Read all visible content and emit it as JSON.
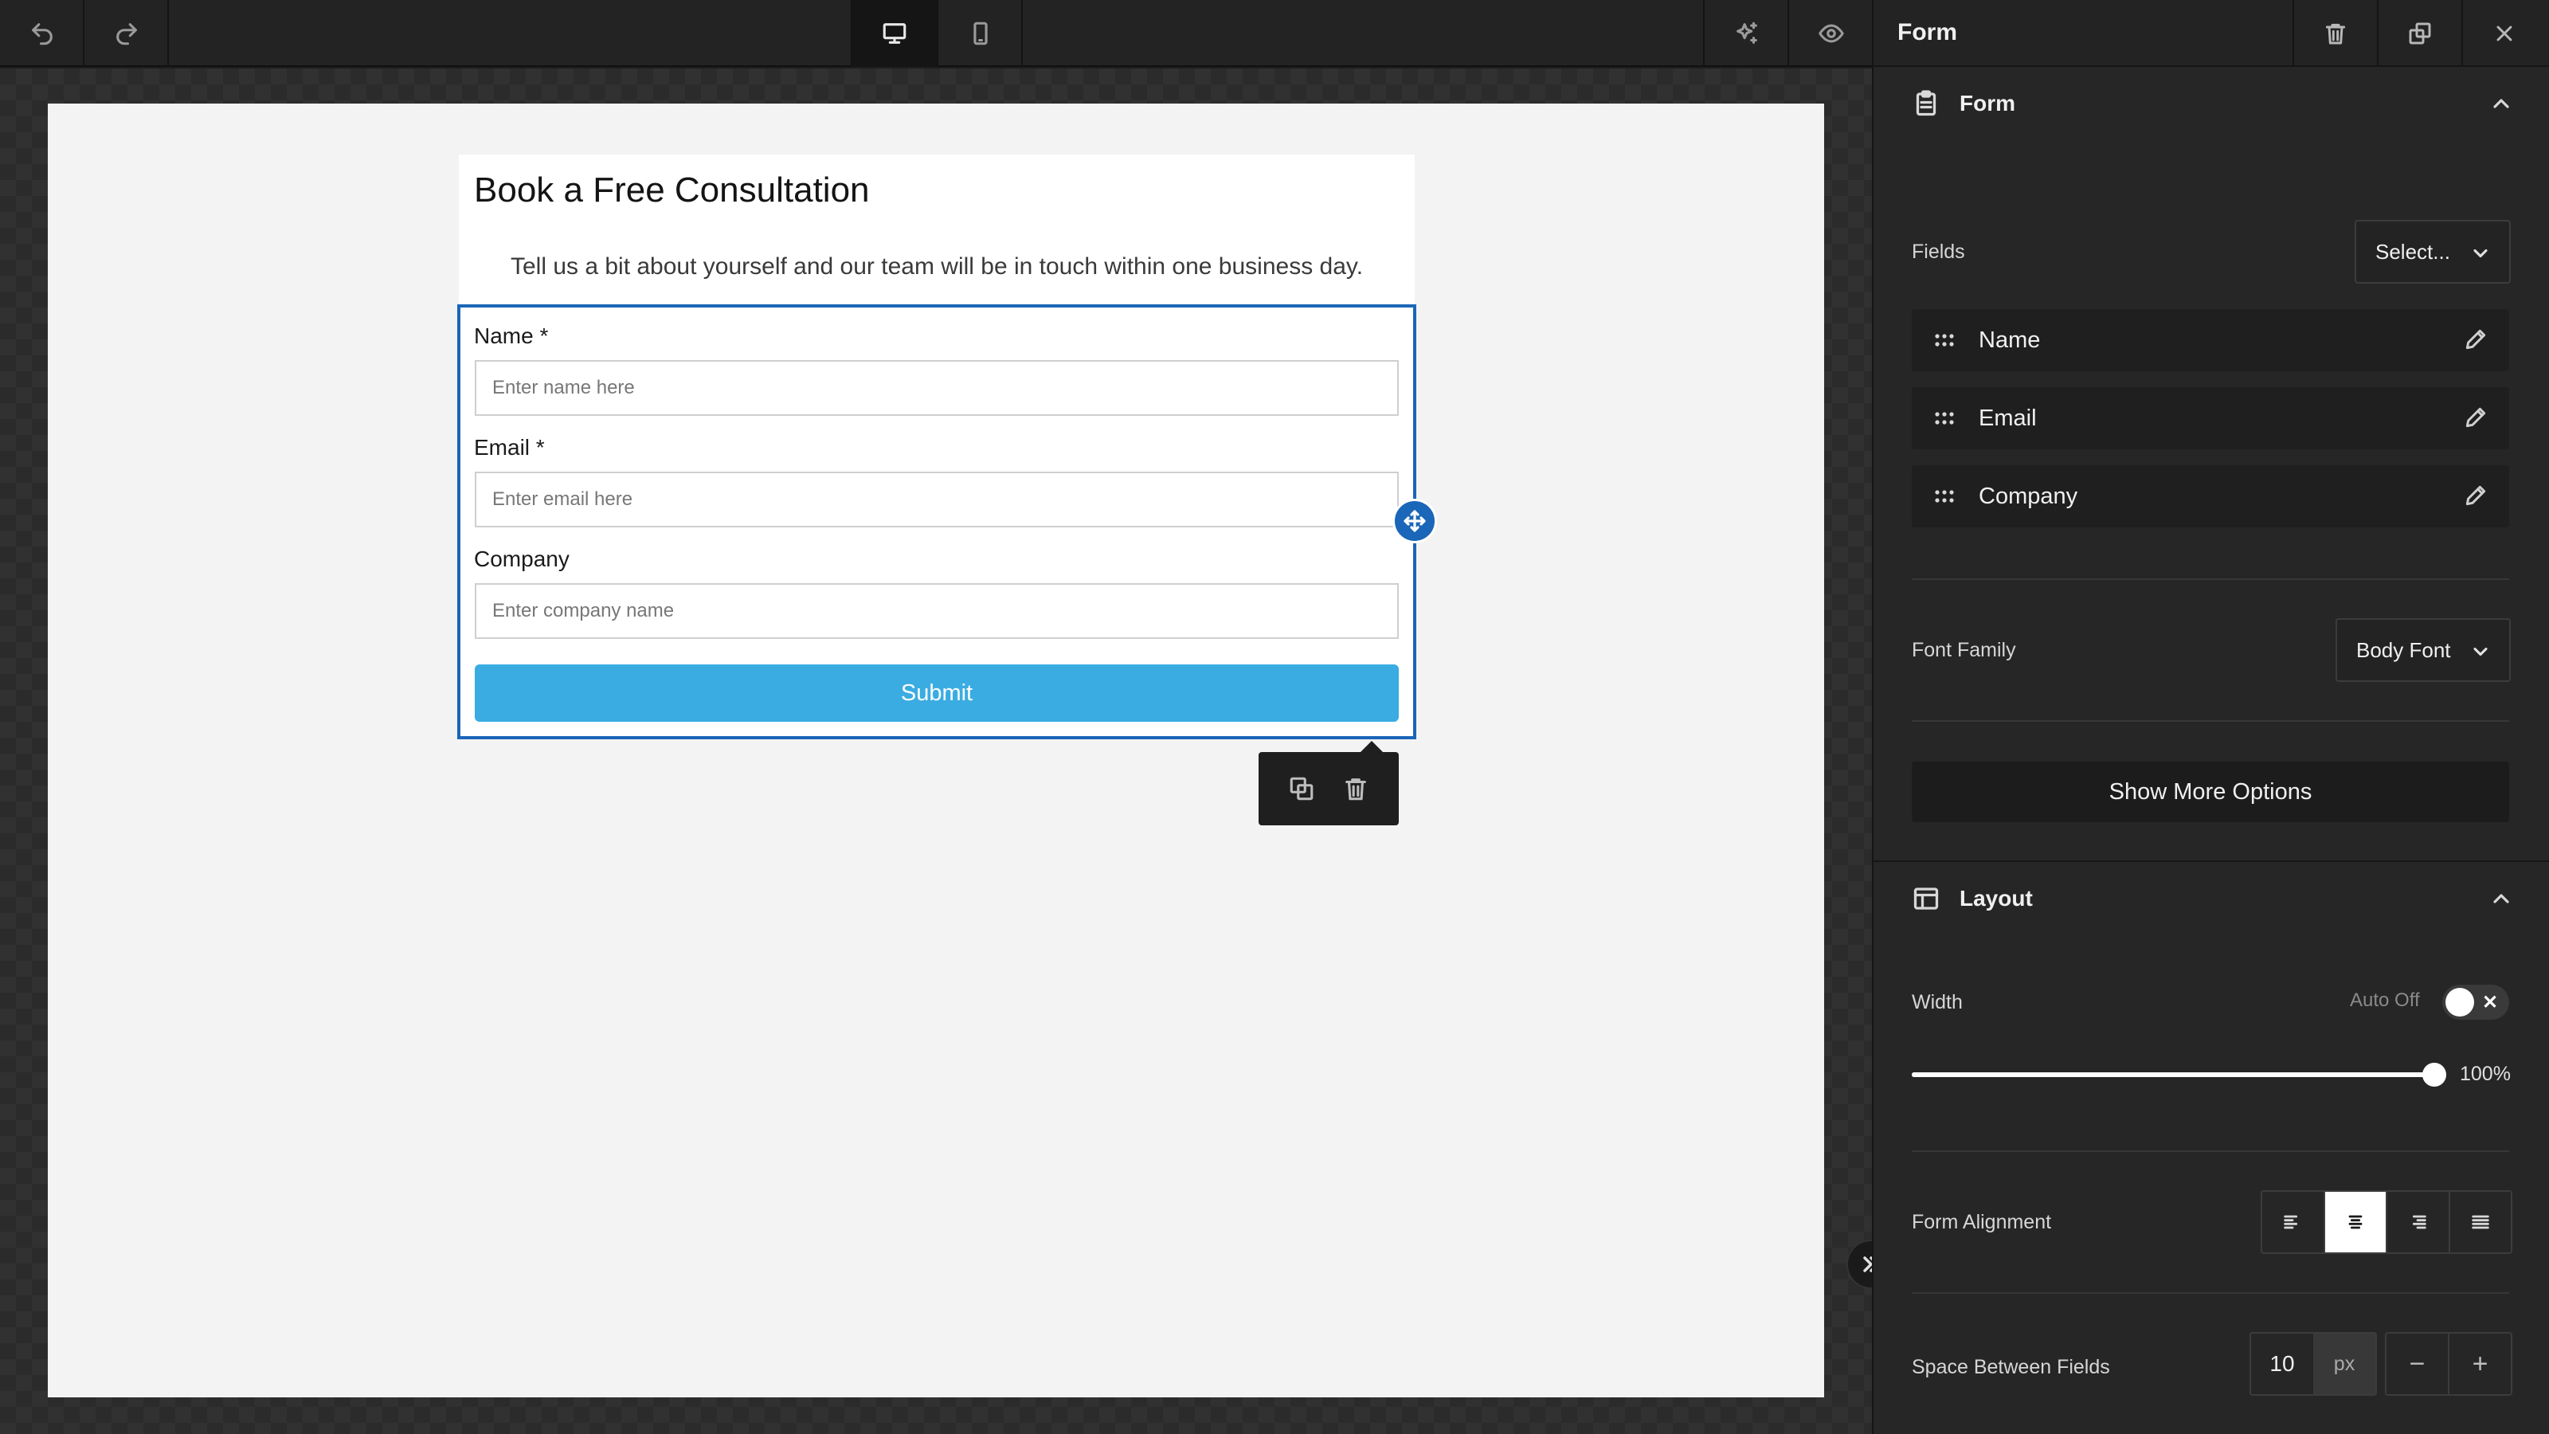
{
  "form_preview": {
    "title": "Book a Free Consultation",
    "subtitle": "Tell us a bit about yourself and our team will be in touch within one business day.",
    "fields": [
      {
        "label": "Name *",
        "placeholder": "Enter name here"
      },
      {
        "label": "Email *",
        "placeholder": "Enter email here"
      },
      {
        "label": "Company",
        "placeholder": "Enter company name"
      }
    ],
    "submit_label": "Submit"
  },
  "panel": {
    "title": "Form",
    "form_section": {
      "title": "Form",
      "fields_label": "Fields",
      "fields_select": "Select...",
      "field_items": [
        "Name",
        "Email",
        "Company"
      ],
      "font_family_label": "Font Family",
      "font_family_value": "Body Font",
      "more_options_label": "Show More Options"
    },
    "layout_section": {
      "title": "Layout",
      "width_label": "Width",
      "auto_label": "Auto Off",
      "auto_on": false,
      "width_value": "100%",
      "width_percent": 100,
      "alignment_label": "Form Alignment",
      "alignment_selected": "center",
      "spacing_label": "Space Between Fields",
      "spacing_value": "10",
      "spacing_unit": "px",
      "minus": "−",
      "plus": "+"
    }
  },
  "colors": {
    "accent": "#1a66b8",
    "submit": "#3aace2"
  }
}
